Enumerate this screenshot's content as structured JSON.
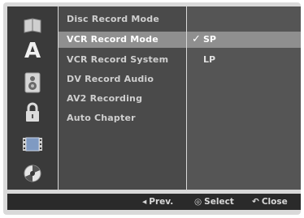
{
  "categories": [
    {
      "icon": "disc-icon"
    },
    {
      "icon": "language-icon",
      "glyph": "A"
    },
    {
      "icon": "speaker-icon"
    },
    {
      "icon": "lock-icon"
    },
    {
      "icon": "film-record-icon"
    },
    {
      "icon": "dvd-disc-icon"
    }
  ],
  "menu": {
    "items": [
      {
        "label": "Disc Record Mode"
      },
      {
        "label": "VCR Record Mode"
      },
      {
        "label": "VCR Record System"
      },
      {
        "label": "DV Record Audio"
      },
      {
        "label": "AV2 Recording"
      },
      {
        "label": "Auto Chapter"
      }
    ],
    "selected_index": 1
  },
  "options": {
    "items": [
      {
        "label": "SP",
        "checked": true
      },
      {
        "label": "LP",
        "checked": false
      }
    ],
    "check_glyph": "✓"
  },
  "footer": {
    "prev_icon": "◂",
    "prev_label": "Prev.",
    "select_icon": "◎",
    "select_label": "Select",
    "close_icon": "↶",
    "close_label": "Close"
  }
}
